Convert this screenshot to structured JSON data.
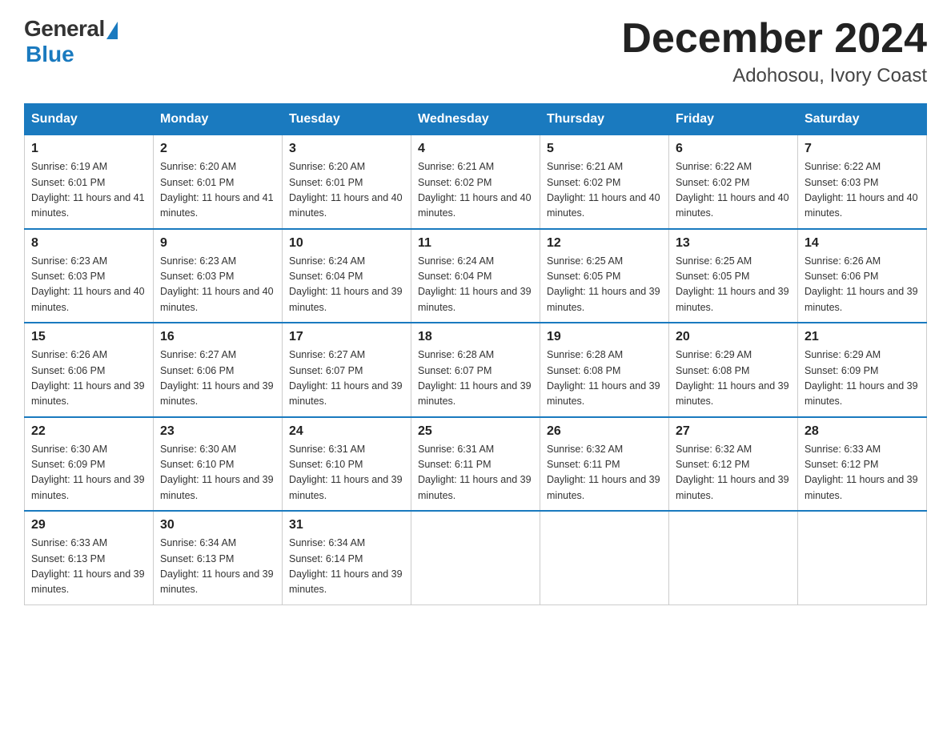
{
  "logo": {
    "general": "General",
    "blue": "Blue"
  },
  "title": "December 2024",
  "subtitle": "Adohosou, Ivory Coast",
  "headers": [
    "Sunday",
    "Monday",
    "Tuesday",
    "Wednesday",
    "Thursday",
    "Friday",
    "Saturday"
  ],
  "weeks": [
    [
      {
        "day": "1",
        "sunrise": "6:19 AM",
        "sunset": "6:01 PM",
        "daylight": "11 hours and 41 minutes."
      },
      {
        "day": "2",
        "sunrise": "6:20 AM",
        "sunset": "6:01 PM",
        "daylight": "11 hours and 41 minutes."
      },
      {
        "day": "3",
        "sunrise": "6:20 AM",
        "sunset": "6:01 PM",
        "daylight": "11 hours and 40 minutes."
      },
      {
        "day": "4",
        "sunrise": "6:21 AM",
        "sunset": "6:02 PM",
        "daylight": "11 hours and 40 minutes."
      },
      {
        "day": "5",
        "sunrise": "6:21 AM",
        "sunset": "6:02 PM",
        "daylight": "11 hours and 40 minutes."
      },
      {
        "day": "6",
        "sunrise": "6:22 AM",
        "sunset": "6:02 PM",
        "daylight": "11 hours and 40 minutes."
      },
      {
        "day": "7",
        "sunrise": "6:22 AM",
        "sunset": "6:03 PM",
        "daylight": "11 hours and 40 minutes."
      }
    ],
    [
      {
        "day": "8",
        "sunrise": "6:23 AM",
        "sunset": "6:03 PM",
        "daylight": "11 hours and 40 minutes."
      },
      {
        "day": "9",
        "sunrise": "6:23 AM",
        "sunset": "6:03 PM",
        "daylight": "11 hours and 40 minutes."
      },
      {
        "day": "10",
        "sunrise": "6:24 AM",
        "sunset": "6:04 PM",
        "daylight": "11 hours and 39 minutes."
      },
      {
        "day": "11",
        "sunrise": "6:24 AM",
        "sunset": "6:04 PM",
        "daylight": "11 hours and 39 minutes."
      },
      {
        "day": "12",
        "sunrise": "6:25 AM",
        "sunset": "6:05 PM",
        "daylight": "11 hours and 39 minutes."
      },
      {
        "day": "13",
        "sunrise": "6:25 AM",
        "sunset": "6:05 PM",
        "daylight": "11 hours and 39 minutes."
      },
      {
        "day": "14",
        "sunrise": "6:26 AM",
        "sunset": "6:06 PM",
        "daylight": "11 hours and 39 minutes."
      }
    ],
    [
      {
        "day": "15",
        "sunrise": "6:26 AM",
        "sunset": "6:06 PM",
        "daylight": "11 hours and 39 minutes."
      },
      {
        "day": "16",
        "sunrise": "6:27 AM",
        "sunset": "6:06 PM",
        "daylight": "11 hours and 39 minutes."
      },
      {
        "day": "17",
        "sunrise": "6:27 AM",
        "sunset": "6:07 PM",
        "daylight": "11 hours and 39 minutes."
      },
      {
        "day": "18",
        "sunrise": "6:28 AM",
        "sunset": "6:07 PM",
        "daylight": "11 hours and 39 minutes."
      },
      {
        "day": "19",
        "sunrise": "6:28 AM",
        "sunset": "6:08 PM",
        "daylight": "11 hours and 39 minutes."
      },
      {
        "day": "20",
        "sunrise": "6:29 AM",
        "sunset": "6:08 PM",
        "daylight": "11 hours and 39 minutes."
      },
      {
        "day": "21",
        "sunrise": "6:29 AM",
        "sunset": "6:09 PM",
        "daylight": "11 hours and 39 minutes."
      }
    ],
    [
      {
        "day": "22",
        "sunrise": "6:30 AM",
        "sunset": "6:09 PM",
        "daylight": "11 hours and 39 minutes."
      },
      {
        "day": "23",
        "sunrise": "6:30 AM",
        "sunset": "6:10 PM",
        "daylight": "11 hours and 39 minutes."
      },
      {
        "day": "24",
        "sunrise": "6:31 AM",
        "sunset": "6:10 PM",
        "daylight": "11 hours and 39 minutes."
      },
      {
        "day": "25",
        "sunrise": "6:31 AM",
        "sunset": "6:11 PM",
        "daylight": "11 hours and 39 minutes."
      },
      {
        "day": "26",
        "sunrise": "6:32 AM",
        "sunset": "6:11 PM",
        "daylight": "11 hours and 39 minutes."
      },
      {
        "day": "27",
        "sunrise": "6:32 AM",
        "sunset": "6:12 PM",
        "daylight": "11 hours and 39 minutes."
      },
      {
        "day": "28",
        "sunrise": "6:33 AM",
        "sunset": "6:12 PM",
        "daylight": "11 hours and 39 minutes."
      }
    ],
    [
      {
        "day": "29",
        "sunrise": "6:33 AM",
        "sunset": "6:13 PM",
        "daylight": "11 hours and 39 minutes."
      },
      {
        "day": "30",
        "sunrise": "6:34 AM",
        "sunset": "6:13 PM",
        "daylight": "11 hours and 39 minutes."
      },
      {
        "day": "31",
        "sunrise": "6:34 AM",
        "sunset": "6:14 PM",
        "daylight": "11 hours and 39 minutes."
      },
      null,
      null,
      null,
      null
    ]
  ]
}
